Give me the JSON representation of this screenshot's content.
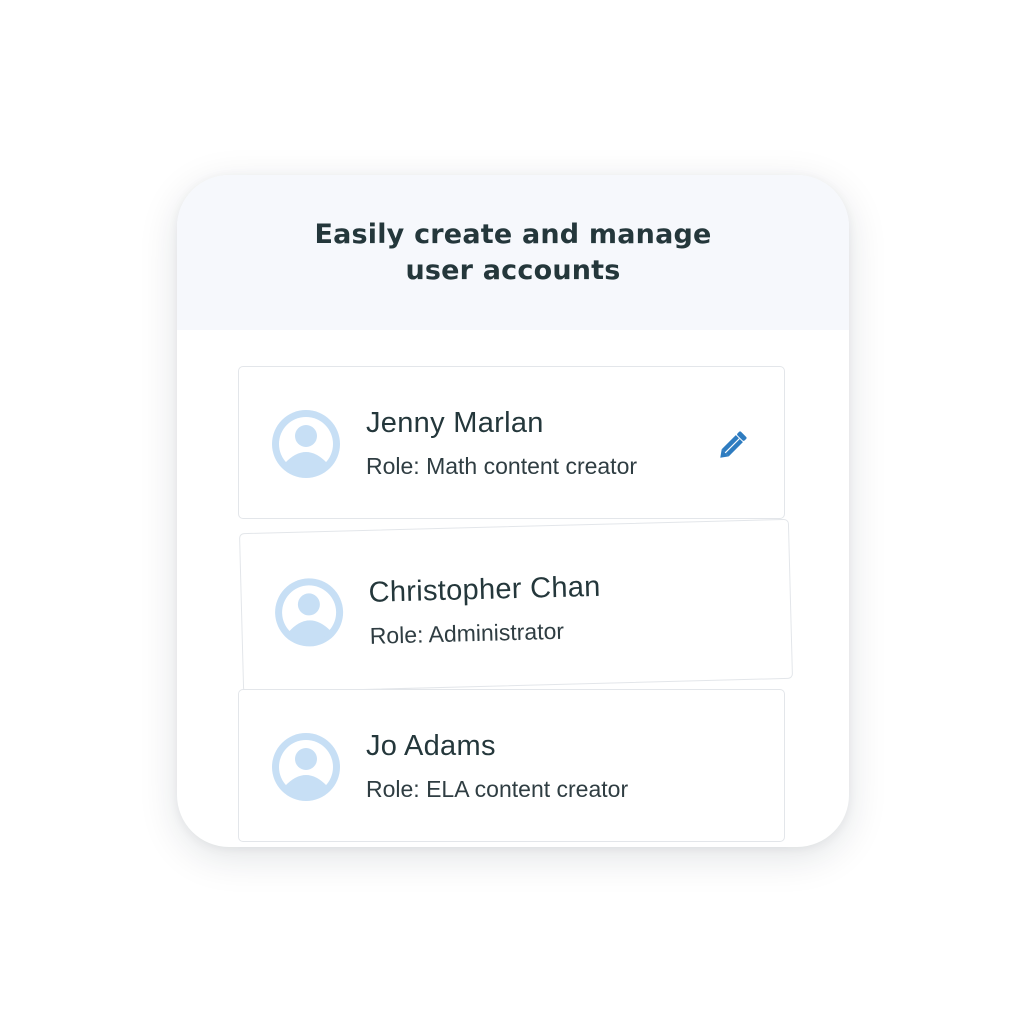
{
  "header": {
    "title": "Easily create and manage user accounts"
  },
  "users": [
    {
      "name": "Jenny Marlan",
      "role": "Role: Math content creator"
    },
    {
      "name": "Christopher Chan",
      "role": "Role: Administrator"
    },
    {
      "name": "Jo Adams",
      "role": "Role: ELA content creator"
    }
  ],
  "icons": {
    "avatar": "user-avatar-icon",
    "edit": "pencil-icon"
  },
  "colors": {
    "header_bg": "#f6f8fc",
    "title_text": "#24373b",
    "avatar_fill": "#c7dff5",
    "pencil": "#2e7cc0"
  }
}
